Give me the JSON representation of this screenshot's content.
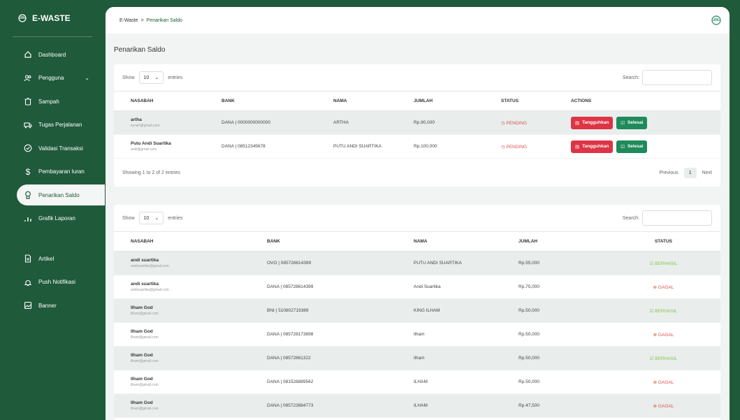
{
  "brand": {
    "name": "E-WASTE"
  },
  "sidebar": {
    "items": [
      {
        "label": "Dashboard"
      },
      {
        "label": "Pengguna"
      },
      {
        "label": "Sampah"
      },
      {
        "label": "Tugas Perjalanan"
      },
      {
        "label": "Validasi Transaksi"
      },
      {
        "label": "Pembayaran Iuran"
      },
      {
        "label": "Penarikan Saldo"
      },
      {
        "label": "Grafik Laporan"
      }
    ],
    "items2": [
      {
        "label": "Artikel"
      },
      {
        "label": "Push Notifikasi"
      },
      {
        "label": "Banner"
      }
    ]
  },
  "breadcrumb": {
    "root": "E-Waste",
    "sep": ">",
    "current": "Penarikan Saldo"
  },
  "page_title": "Penarikan Saldo",
  "table1": {
    "show_label": "Show",
    "length_value": "10",
    "entries_label": "entries",
    "search_label": "Search:",
    "headers": [
      "NASABAH",
      "BANK",
      "NAMA",
      "JUMLAH",
      "STATUS",
      "ACTIONS"
    ],
    "rows": [
      {
        "name": "artha",
        "email": "kynart@gmail.com",
        "bank": "DANA | 0000000000000",
        "nama": "ARTHA",
        "jumlah": "Rp.90,000",
        "status": "PENDING",
        "btn1": "Tangguhkan",
        "btn2": "Selesai"
      },
      {
        "name": "Putu Andi Suartika",
        "email": "andi@gmail.com",
        "bank": "DANA | 08512345678",
        "nama": "PUTU ANDI SUARTIKA",
        "jumlah": "Rp.100,000",
        "status": "PENDING",
        "btn1": "Tangguhkan",
        "btn2": "Selesai"
      }
    ],
    "info": "Showing 1 to 2 of 2 entries",
    "prev": "Previous",
    "page": "1",
    "next": "Next"
  },
  "table2": {
    "show_label": "Show",
    "length_value": "10",
    "entries_label": "entries",
    "search_label": "Search:",
    "headers": [
      "NASABAH",
      "BANK",
      "NAMA",
      "JUMLAH",
      "STATUS"
    ],
    "rows": [
      {
        "name": "andi suartika",
        "email": "andisuartika@gmail.com",
        "bank": "OVO | 085728614399",
        "nama": "PUTU ANDI SUARTIKA",
        "jumlah": "Rp.55,000",
        "status": "BERHASIL"
      },
      {
        "name": "andi suartika",
        "email": "andisuartika@gmail.com",
        "bank": "DANA | 085728614399",
        "nama": "Andi Suartika",
        "jumlah": "Rp.75,000",
        "status": "GAGAL"
      },
      {
        "name": "Ilham God",
        "email": "ilham@gmail.com",
        "bank": "BNI | 510802719389",
        "nama": "KING ILHAM",
        "jumlah": "Rp.50,000",
        "status": "BERHASIL"
      },
      {
        "name": "Ilham God",
        "email": "ilham@gmail.com",
        "bank": "DANA | 085728173898",
        "nama": "ilham",
        "jumlah": "Rp.50,000",
        "status": "GAGAL"
      },
      {
        "name": "Ilham God",
        "email": "ilham@gmail.com",
        "bank": "DANA | 08572861322",
        "nama": "ilham",
        "jumlah": "Rp.50,000",
        "status": "BERHASIL"
      },
      {
        "name": "Ilham God",
        "email": "ilham@gmail.com",
        "bank": "DANA | 081526889562",
        "nama": "ILHAM",
        "jumlah": "Rp.50,000",
        "status": "GAGAL"
      },
      {
        "name": "Ilham God",
        "email": "ilham@gmail.com",
        "bank": "DANA | 085723884773",
        "nama": "ILHAM",
        "jumlah": "Rp.47,500",
        "status": "GAGAL"
      }
    ]
  },
  "colors": {
    "sidebar": "#1f5a3a",
    "accent": "#1f8a5a",
    "danger": "#dc3545",
    "success_text": "#8bc34a"
  }
}
